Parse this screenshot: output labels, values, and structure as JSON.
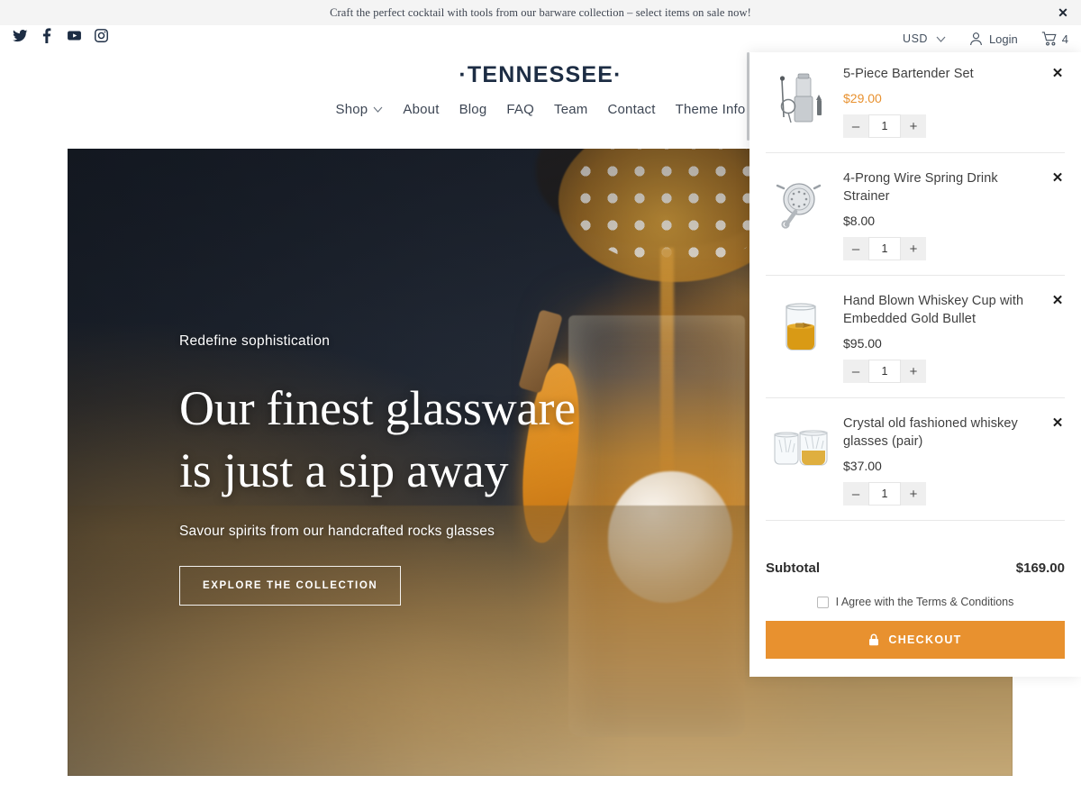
{
  "announcement": {
    "text": "Craft the perfect cocktail with tools from our barware collection – select items on sale now!",
    "close_label": "✕"
  },
  "utility": {
    "social": [
      {
        "name": "twitter-icon",
        "label": "Twitter"
      },
      {
        "name": "facebook-icon",
        "label": "Facebook"
      },
      {
        "name": "youtube-icon",
        "label": "YouTube"
      },
      {
        "name": "instagram-icon",
        "label": "Instagram"
      }
    ],
    "currency": "USD",
    "login_label": "Login",
    "cart_count": "4"
  },
  "brand": {
    "logo": "·TENNESSEE·"
  },
  "nav": {
    "items": [
      {
        "label": "Shop",
        "has_dropdown": true
      },
      {
        "label": "About",
        "has_dropdown": false
      },
      {
        "label": "Blog",
        "has_dropdown": false
      },
      {
        "label": "FAQ",
        "has_dropdown": false
      },
      {
        "label": "Team",
        "has_dropdown": false
      },
      {
        "label": "Contact",
        "has_dropdown": false
      },
      {
        "label": "Theme Info",
        "has_dropdown": false
      }
    ]
  },
  "hero": {
    "kicker": "Redefine sophistication",
    "title_line1": "Our finest glassware",
    "title_line2": "is just a sip away",
    "subtitle": "Savour spirits from our handcrafted rocks glasses",
    "cta_label": "EXPLORE THE COLLECTION"
  },
  "cart": {
    "items": [
      {
        "title": "5-Piece Bartender Set",
        "price": "$29.00",
        "on_sale": true,
        "quantity": "1",
        "thumb": "bartender-set-thumb"
      },
      {
        "title": "4-Prong Wire Spring Drink Strainer",
        "price": "$8.00",
        "on_sale": false,
        "quantity": "1",
        "thumb": "strainer-thumb"
      },
      {
        "title": "Hand Blown Whiskey Cup with Embedded Gold Bullet",
        "price": "$95.00",
        "on_sale": false,
        "quantity": "1",
        "thumb": "whiskey-cup-thumb"
      },
      {
        "title": "Crystal old fashioned whiskey glasses (pair)",
        "price": "$37.00",
        "on_sale": false,
        "quantity": "1",
        "thumb": "crystal-glasses-thumb"
      }
    ],
    "subtotal_label": "Subtotal",
    "subtotal_value": "$169.00",
    "terms_label": "I Agree with the Terms & Conditions",
    "checkout_label": "CHECKOUT",
    "remove_label": "✕",
    "minus_label": "–",
    "plus_label": "+"
  },
  "colors": {
    "brand_navy": "#1d2d44",
    "accent_orange": "#e8912f",
    "banner_bg": "#f4f4f4"
  }
}
